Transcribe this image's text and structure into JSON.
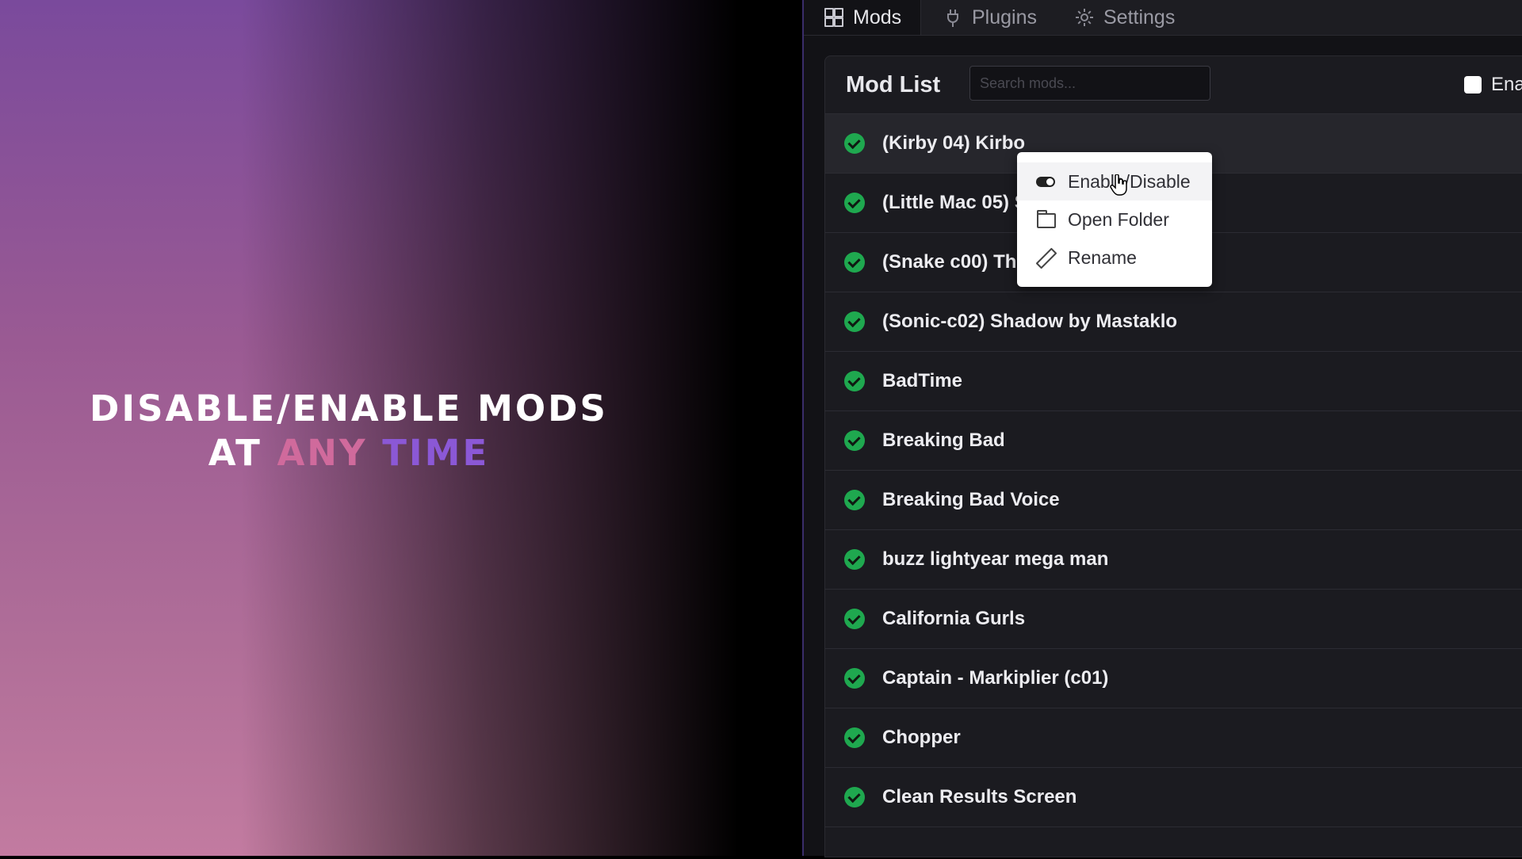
{
  "promo": {
    "line1": "DISABLE/ENABLE MODS",
    "line2_prefix": "AT",
    "line2_pink": "ANY",
    "line2_purple": "TIME"
  },
  "tabs": [
    {
      "label": "Mods",
      "icon": "grid-icon",
      "active": true
    },
    {
      "label": "Plugins",
      "icon": "plug-icon",
      "active": false
    },
    {
      "label": "Settings",
      "icon": "gear-icon",
      "active": false
    }
  ],
  "mod_list": {
    "title": "Mod List",
    "search_placeholder": "Search mods...",
    "enable_all_label": "Ena",
    "items": [
      {
        "label": "(Kirby 04) Kirbo",
        "enabled": true
      },
      {
        "label": "(Little Mac 05) S",
        "enabled": true
      },
      {
        "label": "(Snake c00) The",
        "enabled": true
      },
      {
        "label": "(Sonic-c02) Shadow by Mastaklo",
        "enabled": true
      },
      {
        "label": "BadTime",
        "enabled": true
      },
      {
        "label": "Breaking Bad",
        "enabled": true
      },
      {
        "label": "Breaking Bad Voice",
        "enabled": true
      },
      {
        "label": "buzz lightyear mega man",
        "enabled": true
      },
      {
        "label": "California Gurls",
        "enabled": true
      },
      {
        "label": "Captain - Markiplier (c01)",
        "enabled": true
      },
      {
        "label": "Chopper",
        "enabled": true
      },
      {
        "label": "Clean Results Screen",
        "enabled": true
      }
    ]
  },
  "context_menu": {
    "items": [
      {
        "label": "Enable/Disable",
        "icon": "toggle-icon"
      },
      {
        "label": "Open Folder",
        "icon": "folder-icon"
      },
      {
        "label": "Rename",
        "icon": "pencil-icon"
      }
    ]
  },
  "colors": {
    "accent_pink": "#d06a9c",
    "accent_purple": "#8b58d6",
    "enabled_green": "#1fa84f"
  }
}
